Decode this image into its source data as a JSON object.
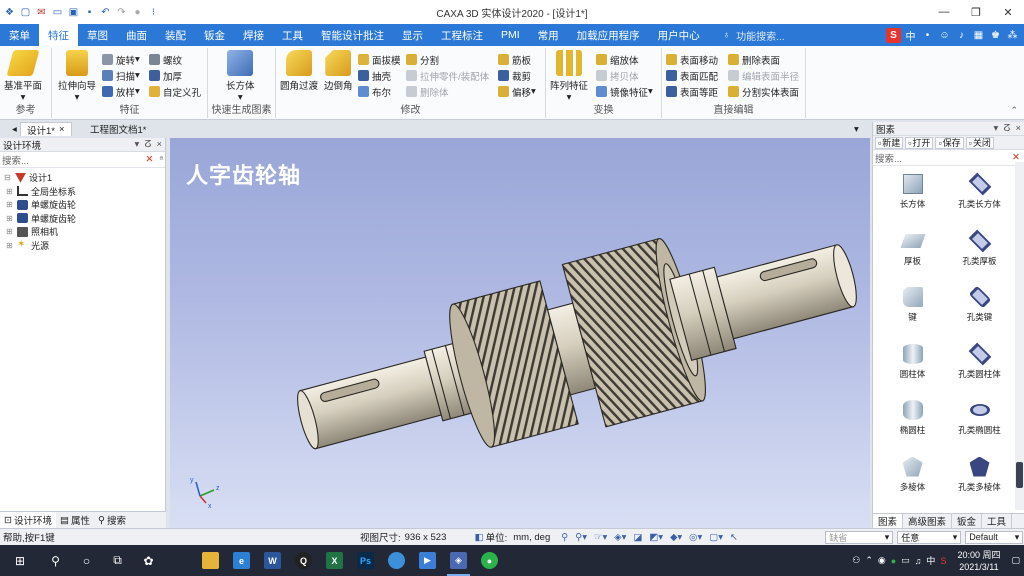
{
  "window": {
    "title": "CAXA 3D 实体设计2020 - [设计1*]",
    "controls": [
      "—",
      "❐",
      "✕"
    ]
  },
  "menu": {
    "tabs": [
      "菜单",
      "特征",
      "草图",
      "曲面",
      "装配",
      "钣金",
      "焊接",
      "工具",
      "智能设计批注",
      "显示",
      "工程标注",
      "PMI",
      "常用",
      "加载应用程序",
      "用户中心"
    ],
    "help_search": "功能搜索..."
  },
  "ime": {
    "label": "中"
  },
  "ribbon": {
    "groups": {
      "reference": "参考",
      "feature": "特征",
      "quick": "快速生成图素",
      "modify": "修改",
      "transform": "变换",
      "direct": "直接编辑"
    },
    "ref_plane": "基准平面",
    "extrude": "拉伸向导",
    "feature_items": [
      "旋转",
      "扫描",
      "放样",
      "螺纹",
      "加厚",
      "自定义孔"
    ],
    "cuboid": "长方体",
    "fillet": "圆角过渡",
    "chamfer": "边倒角",
    "modify_items": [
      {
        "label": "面拔模",
        "enabled": true
      },
      {
        "label": "抽壳",
        "enabled": true
      },
      {
        "label": "布尔",
        "enabled": true
      },
      {
        "label": "分割",
        "enabled": true
      },
      {
        "label": "拉伸零件/装配体",
        "enabled": false
      },
      {
        "label": "删除体",
        "enabled": false
      },
      {
        "label": "筋板",
        "enabled": true
      },
      {
        "label": "裁剪",
        "enabled": true
      },
      {
        "label": "偏移",
        "enabled": true
      }
    ],
    "array": "阵列特征",
    "transform_items": [
      {
        "label": "缩放体",
        "enabled": true
      },
      {
        "label": "拷贝体",
        "enabled": false
      },
      {
        "label": "镜像特征",
        "enabled": true
      }
    ],
    "direct_items": [
      {
        "label": "表面移动",
        "enabled": true
      },
      {
        "label": "表面匹配",
        "enabled": true
      },
      {
        "label": "表面等距",
        "enabled": true
      },
      {
        "label": "删除表面",
        "enabled": true
      },
      {
        "label": "编辑表面半径",
        "enabled": false
      },
      {
        "label": "分割实体表面",
        "enabled": true
      }
    ]
  },
  "doc_tabs": [
    "设计1*",
    "工程图文档1*"
  ],
  "left_panel": {
    "title": "设计环境",
    "search_placeholder": "搜索...",
    "tree": [
      {
        "label": "设计1",
        "level": 0
      },
      {
        "label": "全局坐标系",
        "level": 1
      },
      {
        "label": "单螺旋齿轮",
        "level": 1
      },
      {
        "label": "单螺旋齿轮",
        "level": 1
      },
      {
        "label": "照相机",
        "level": 1
      },
      {
        "label": "光源",
        "level": 1
      }
    ],
    "bottom_tabs": [
      "设计环境",
      "属性",
      "搜索"
    ]
  },
  "viewport": {
    "title": "人字齿轮轴",
    "axes": [
      "x",
      "y",
      "z"
    ]
  },
  "right_panel": {
    "title": "图素",
    "buttons": [
      "新建",
      "打开",
      "保存",
      "关闭"
    ],
    "search_placeholder": "搜索...",
    "items": [
      {
        "label": "长方体",
        "shape": "cube"
      },
      {
        "label": "孔类长方体",
        "shape": "hole-cube"
      },
      {
        "label": "厚板",
        "shape": "plate"
      },
      {
        "label": "孔类厚板",
        "shape": "hole-plate"
      },
      {
        "label": "键",
        "shape": "key"
      },
      {
        "label": "孔类键",
        "shape": "hole-key"
      },
      {
        "label": "圆柱体",
        "shape": "cyl"
      },
      {
        "label": "孔类圆柱体",
        "shape": "hole-cyl"
      },
      {
        "label": "椭圆柱",
        "shape": "ecyl"
      },
      {
        "label": "孔类椭圆柱",
        "shape": "hole-ecyl"
      },
      {
        "label": "多棱体",
        "shape": "prism"
      },
      {
        "label": "孔类多棱体",
        "shape": "hole-prism"
      }
    ],
    "bottom_tabs": [
      "图素",
      "高级图素",
      "钣金",
      "工具"
    ]
  },
  "status": {
    "help": "帮助,按F1键",
    "view_size_label": "视图尺寸:",
    "view_size": "936 x 523",
    "unit_label": "单位:",
    "unit": "mm, deg",
    "snap": "缺省",
    "select_mode": "任意",
    "style": "Default"
  },
  "taskbar": {
    "time": "20:00 周四",
    "date": "2021/3/11",
    "lang": "中"
  }
}
